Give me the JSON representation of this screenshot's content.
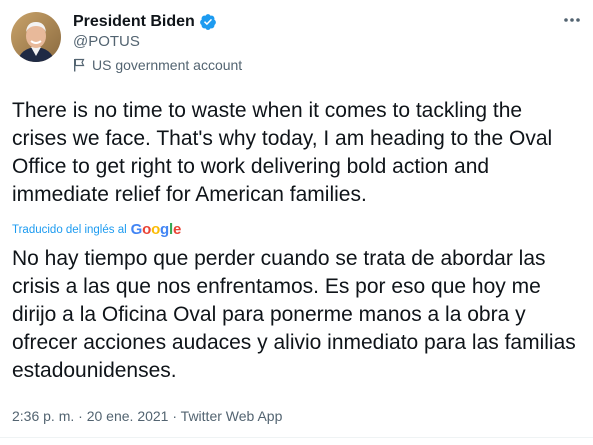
{
  "author": {
    "name": "President Biden",
    "handle": "@POTUS",
    "label": "US government account"
  },
  "tweet": {
    "text_en": "There is no time to waste when it comes to tackling the crises we face. That's why today, I am heading to the Oval Office to get right to work delivering bold action and immediate relief for American families.",
    "translated_label": "Traducido del inglés al",
    "translator_brand": [
      "G",
      "o",
      "o",
      "g",
      "l",
      "e"
    ],
    "text_es": "No hay tiempo que perder cuando se trata de abordar las crisis a las que nos enfrentamos. Es por eso que hoy me dirijo a la Oficina Oval para ponerme manos a la obra y ofrecer acciones audaces y alivio inmediato para las familias estadounidenses."
  },
  "meta": {
    "time": "2:36 p. m.",
    "sep1": " · ",
    "date": "20 ene. 2021",
    "sep2": " · ",
    "source": "Twitter Web App"
  },
  "icons": {
    "verified": "verified-badge-icon",
    "flag": "flag-icon",
    "more": "more-options-icon"
  },
  "colors": {
    "verified": "#1d9bf0",
    "link": "#1d9bf0",
    "secondary_text": "#536471"
  }
}
